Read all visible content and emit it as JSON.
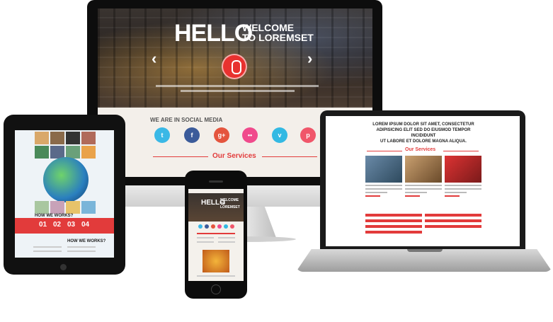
{
  "desktop": {
    "hero_title_big": "HELLO",
    "hero_title_small_1": "WELCOME",
    "hero_title_small_2": "TO LOREMSET",
    "prev_arrow": "‹",
    "next_arrow": "›",
    "social_title": "WE ARE IN SOCIAL MEDIA",
    "social_icons": [
      {
        "name": "twitter-icon",
        "glyph": "t",
        "color": "#3ab8e6"
      },
      {
        "name": "facebook-icon",
        "glyph": "f",
        "color": "#3b5b9a"
      },
      {
        "name": "googleplus-icon",
        "glyph": "g+",
        "color": "#e4553e"
      },
      {
        "name": "flickr-icon",
        "glyph": "••",
        "color": "#f04a8c"
      },
      {
        "name": "vimeo-icon",
        "glyph": "v",
        "color": "#33b9e3"
      },
      {
        "name": "pinterest-icon",
        "glyph": "p",
        "color": "#f0566a"
      }
    ],
    "services_title": "Our Services"
  },
  "laptop": {
    "headline_1": "LOREM IPSUM DOLOR SIT AMET, CONSECTETUR",
    "headline_2": "ADIPISICING ELIT SED DO EIUSMOD TEMPOR INCIDIDUNT",
    "headline_3": "UT LABORE ET DOLORE MAGNA ALIQUA.",
    "services_title": "Our Services"
  },
  "tablet": {
    "how_title_1": "HOW WE WORKS?",
    "how_title_2": "HOW WE WORKS?",
    "steps": [
      "01",
      "02",
      "03",
      "04"
    ]
  },
  "phone": {
    "hero_title_big": "HELLO",
    "hero_title_small_1": "WELCOME",
    "hero_title_small_2": "TO LOREMSET"
  },
  "colors": {
    "accent": "#e23b3b",
    "text_dark": "#222222"
  }
}
